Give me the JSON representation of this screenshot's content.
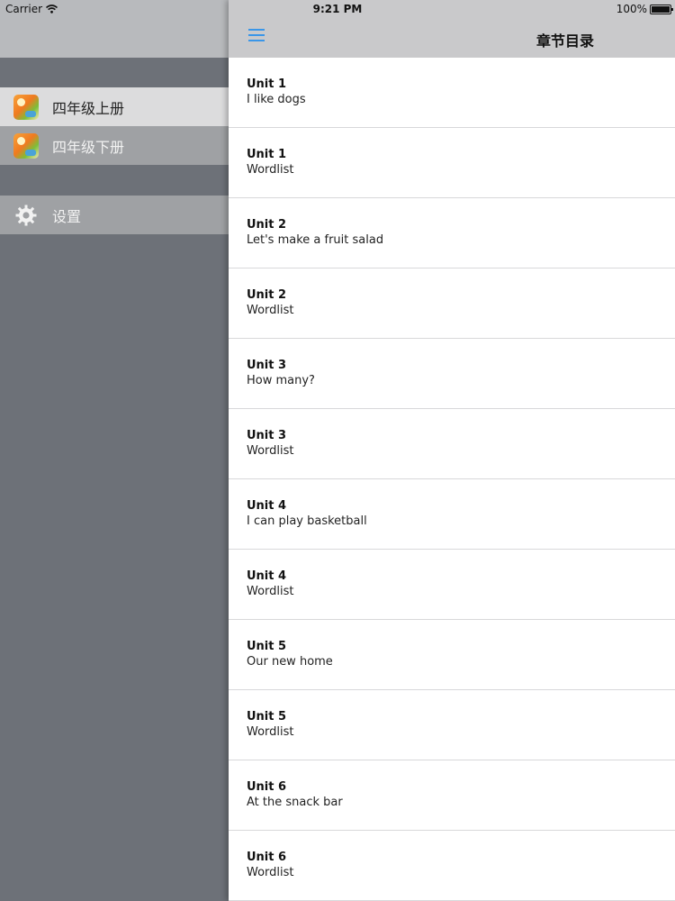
{
  "status_bar": {
    "carrier": "Carrier",
    "time": "9:21 PM",
    "battery": "100%"
  },
  "drawer": {
    "books": [
      {
        "label": "四年级上册",
        "selected": true
      },
      {
        "label": "四年级下册",
        "selected": false
      }
    ],
    "settings_label": "设置"
  },
  "navbar": {
    "title": "章节目录",
    "menu_icon": "hamburger-icon",
    "accent": "#3a96e8"
  },
  "chapters": [
    {
      "unit": "Unit 1",
      "title": "I like dogs"
    },
    {
      "unit": "Unit 1",
      "title": "Wordlist"
    },
    {
      "unit": "Unit 2",
      "title": "Let's make a fruit salad"
    },
    {
      "unit": "Unit 2",
      "title": "Wordlist"
    },
    {
      "unit": "Unit 3",
      "title": "How many?"
    },
    {
      "unit": "Unit 3",
      "title": "Wordlist"
    },
    {
      "unit": "Unit 4",
      "title": "I can play basketball"
    },
    {
      "unit": "Unit 4",
      "title": "Wordlist"
    },
    {
      "unit": "Unit 5",
      "title": "Our new home"
    },
    {
      "unit": "Unit 5",
      "title": "Wordlist"
    },
    {
      "unit": "Unit 6",
      "title": "At the snack bar"
    },
    {
      "unit": "Unit 6",
      "title": "Wordlist"
    }
  ]
}
